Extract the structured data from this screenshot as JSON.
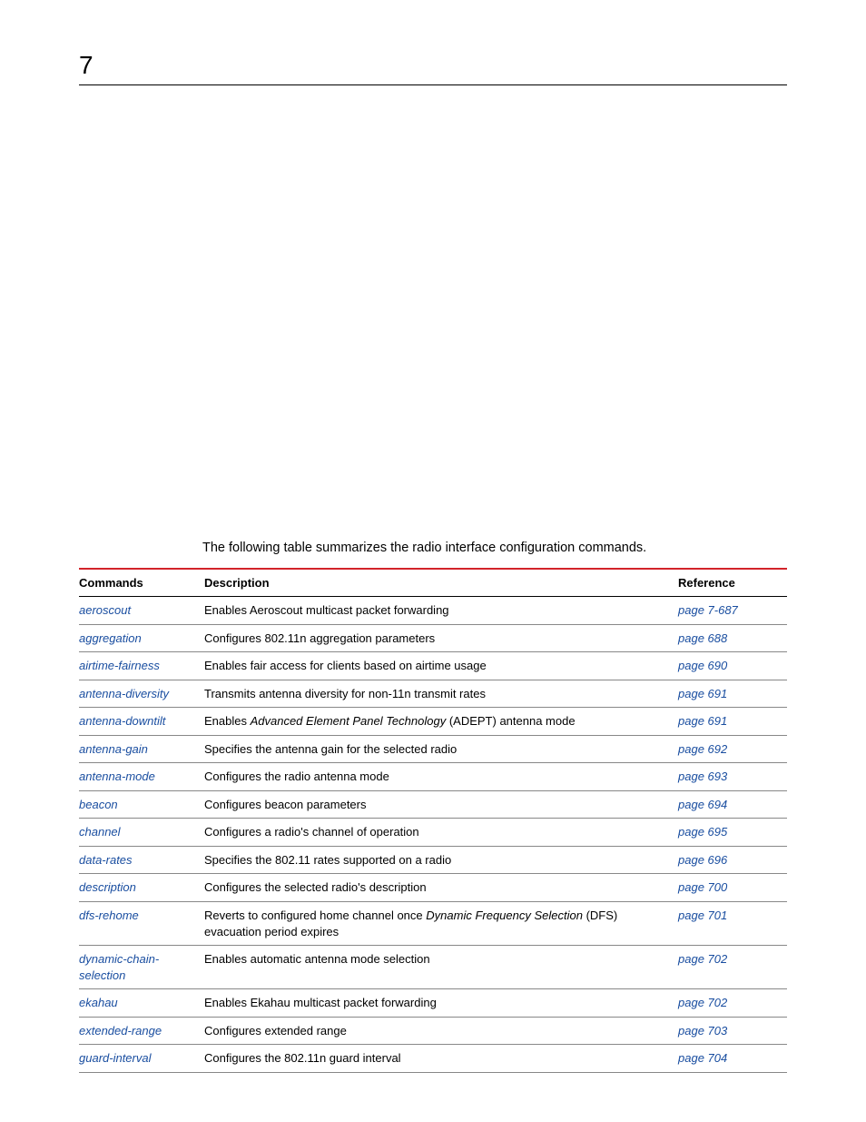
{
  "page_number": "7",
  "intro_text": "The following table summarizes the radio interface configuration commands.",
  "headers": {
    "commands": "Commands",
    "description": "Description",
    "reference": "Reference"
  },
  "rows": [
    {
      "cmd": "aeroscout",
      "desc_pre": "Enables Aeroscout multicast packet forwarding",
      "ref": "page 7-687"
    },
    {
      "cmd": "aggregation",
      "desc_pre": "Configures 802.11n aggregation parameters",
      "ref": "page 688"
    },
    {
      "cmd": "airtime-fairness",
      "desc_pre": "Enables fair access for clients based on airtime usage",
      "ref": "page 690"
    },
    {
      "cmd": "antenna-diversity",
      "desc_pre": "Transmits antenna diversity for non-11n transmit rates",
      "ref": "page 691"
    },
    {
      "cmd": "antenna-downtilt",
      "desc_pre": "Enables ",
      "desc_it": "Advanced Element Panel Technology",
      "desc_post": " (ADEPT) antenna mode",
      "ref": "page 691"
    },
    {
      "cmd": "antenna-gain",
      "desc_pre": "Specifies the antenna gain for the selected radio",
      "ref": "page 692"
    },
    {
      "cmd": "antenna-mode",
      "desc_pre": "Configures the radio antenna mode",
      "ref": "page 693"
    },
    {
      "cmd": "beacon",
      "desc_pre": "Configures beacon parameters",
      "ref": "page 694"
    },
    {
      "cmd": "channel",
      "desc_pre": "Configures a radio's channel of operation",
      "ref": "page 695"
    },
    {
      "cmd": "data-rates",
      "desc_pre": "Specifies the 802.11 rates supported on a radio",
      "ref": "page 696"
    },
    {
      "cmd": "description",
      "desc_pre": "Configures the selected radio's description",
      "ref": "page 700"
    },
    {
      "cmd": "dfs-rehome",
      "desc_pre": "Reverts to configured home channel once ",
      "desc_it": "Dynamic Frequency Selection",
      "desc_post": " (DFS) evacuation period expires",
      "ref": "page 701"
    },
    {
      "cmd": "dynamic-chain-selection",
      "desc_pre": "Enables automatic antenna mode selection",
      "ref": "page 702"
    },
    {
      "cmd": "ekahau",
      "desc_pre": "Enables Ekahau multicast packet forwarding",
      "ref": "page 702"
    },
    {
      "cmd": "extended-range",
      "desc_pre": "Configures extended range",
      "ref": "page 703"
    },
    {
      "cmd": "guard-interval",
      "desc_pre": "Configures the 802.11n guard interval",
      "ref": "page 704"
    }
  ]
}
